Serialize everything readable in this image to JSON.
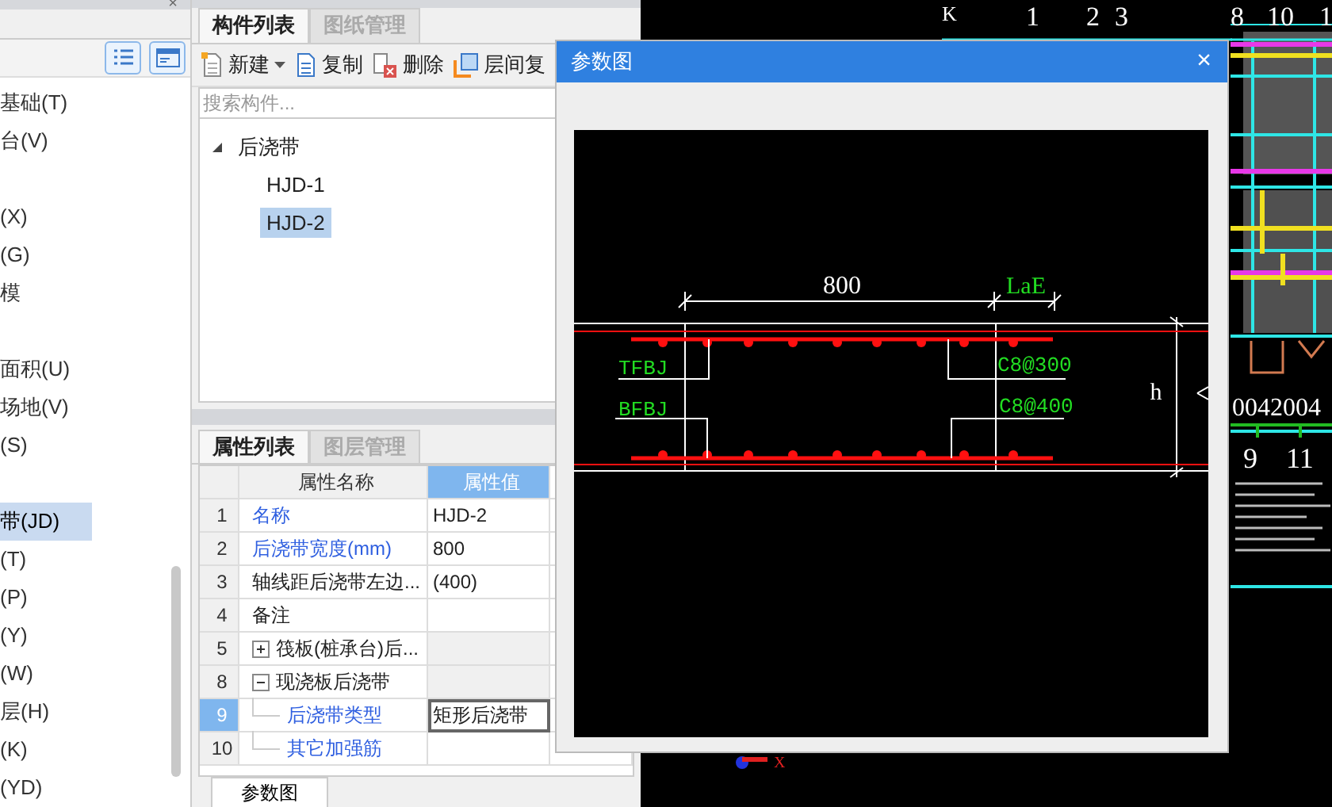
{
  "sidebar": {
    "close": "×",
    "items": [
      {
        "label": "基础(T)",
        "selected": false
      },
      {
        "label": "台(V)",
        "selected": false
      },
      {
        "kind": "gap"
      },
      {
        "label": "(X)",
        "selected": false
      },
      {
        "label": "(G)",
        "selected": false
      },
      {
        "label": "模",
        "selected": false
      },
      {
        "kind": "gap"
      },
      {
        "label": "面积(U)",
        "selected": false
      },
      {
        "label": "场地(V)",
        "selected": false
      },
      {
        "label": "(S)",
        "selected": false
      },
      {
        "kind": "gap"
      },
      {
        "label": "带(JD)",
        "selected": true
      },
      {
        "label": "(T)",
        "selected": false
      },
      {
        "label": "(P)",
        "selected": false
      },
      {
        "label": "(Y)",
        "selected": false
      },
      {
        "label": "(W)",
        "selected": false
      },
      {
        "label": "层(H)",
        "selected": false
      },
      {
        "label": "(K)",
        "selected": false
      },
      {
        "label": "(YD)",
        "selected": false
      }
    ]
  },
  "component_panel": {
    "tabs": [
      {
        "label": "构件列表",
        "selected": true
      },
      {
        "label": "图纸管理",
        "selected": false
      }
    ],
    "toolbar": [
      {
        "label": "新建",
        "kind": "new",
        "dropdown": true
      },
      {
        "label": "复制",
        "kind": "copy",
        "dropdown": false
      },
      {
        "label": "删除",
        "kind": "delete",
        "dropdown": false
      },
      {
        "label": "层间复",
        "kind": "floor-copy",
        "dropdown": false
      }
    ],
    "search": {
      "placeholder": "搜索构件..."
    },
    "tree": [
      {
        "label": "后浇带",
        "expanded": true,
        "selected": false,
        "children": [
          {
            "label": "HJD-1",
            "selected": false
          },
          {
            "label": "HJD-2",
            "selected": true
          }
        ]
      }
    ]
  },
  "property_panel": {
    "tabs": [
      {
        "label": "属性列表",
        "selected": true
      },
      {
        "label": "图层管理",
        "selected": false
      }
    ],
    "columns": [
      {
        "label": "属性名称",
        "selected": false
      },
      {
        "label": "属性值",
        "selected": true
      }
    ],
    "rows": [
      {
        "kind": "property",
        "number": "1",
        "name": "名称",
        "value": "HJD-2",
        "emphasized": true,
        "selected": false
      },
      {
        "kind": "property",
        "number": "2",
        "name": "后浇带宽度(mm)",
        "value": "800",
        "emphasized": true,
        "selected": false
      },
      {
        "kind": "property",
        "number": "3",
        "name": "轴线距后浇带左边...",
        "value": "(400)",
        "emphasized": false,
        "selected": false
      },
      {
        "kind": "property",
        "number": "4",
        "name": "备注",
        "emphasized": false,
        "selected": false
      },
      {
        "kind": "group",
        "number": "5",
        "name": "筏板(桩承台)后...",
        "expanded": false,
        "children": []
      },
      {
        "kind": "group",
        "number": "8",
        "name": "现浇板后浇带",
        "expanded": true,
        "children": [
          {
            "kind": "property",
            "number": "9",
            "name": "后浇带类型",
            "value": "矩形后浇带",
            "emphasized": true,
            "selected": true
          },
          {
            "kind": "property",
            "number": "10",
            "name": "其它加强筋",
            "emphasized": true,
            "selected": false
          }
        ]
      }
    ],
    "bottom_tab": "参数图"
  },
  "dialog": {
    "title": "参数图",
    "close": "×",
    "diagram": {
      "labels": [
        "800",
        "LaE",
        "TFBJ",
        "BFBJ",
        "C8@300",
        "C8@400",
        "h"
      ]
    }
  },
  "canvas": {
    "labels": [
      "K",
      "1",
      "2",
      "3",
      "8",
      "10",
      "1",
      "0042004",
      "9",
      "11",
      "X"
    ]
  }
}
